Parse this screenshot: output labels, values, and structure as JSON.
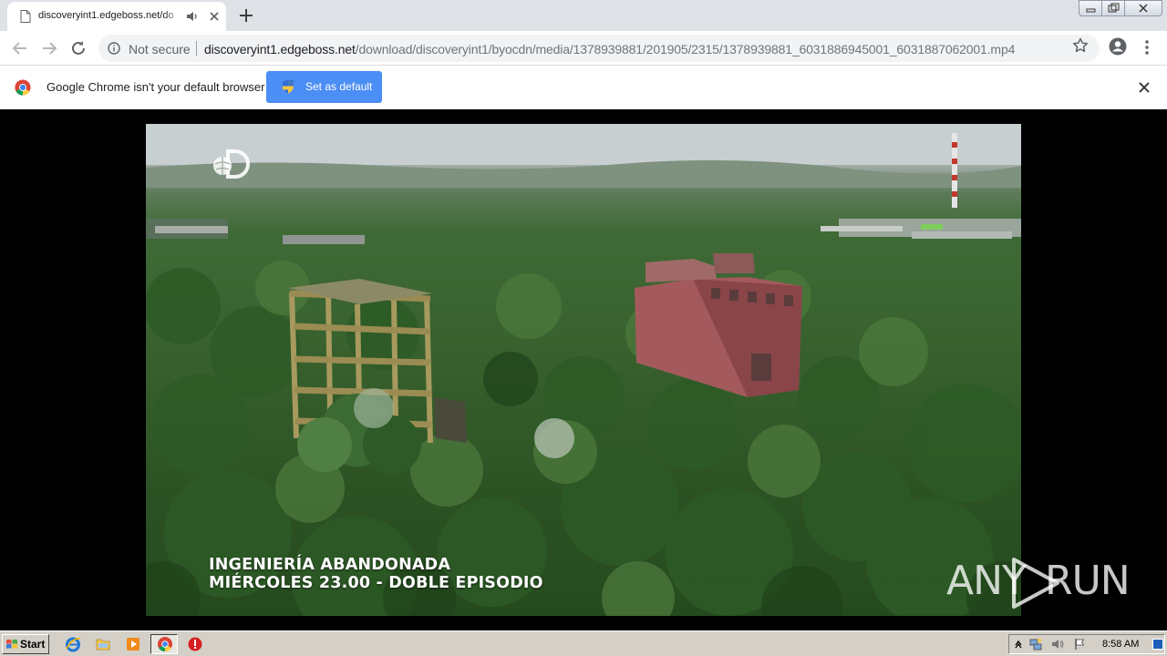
{
  "browser": {
    "tab": {
      "title": "discoveryint1.edgeboss.net/do"
    },
    "omnibox": {
      "security_label": "Not secure",
      "url_host": "discoveryint1.edgeboss.net",
      "url_path": "/download/discoveryint1/byocdn/media/1378939881/201905/2315/1378939881_6031886945001_6031887062001.mp4"
    },
    "infobar": {
      "message": "Google Chrome isn't your default browser",
      "button_label": "Set as default"
    }
  },
  "video": {
    "overlay_line1": "INGENIERÍA ABANDONADA",
    "overlay_line2": "MIÉRCOLES 23.00 - DOBLE EPISODIO",
    "watermark_left": "ANY",
    "watermark_right": "RUN"
  },
  "taskbar": {
    "start_label": "Start",
    "clock": "8:58 AM",
    "pinned_icons": [
      "internet-explorer-icon",
      "folder-icon",
      "media-player-icon",
      "chrome-icon",
      "stop-icon"
    ]
  },
  "colors": {
    "accent_blue": "#4b8ef5",
    "tabstrip": "#dee1e6",
    "taskbar": "#d4d0c8"
  }
}
